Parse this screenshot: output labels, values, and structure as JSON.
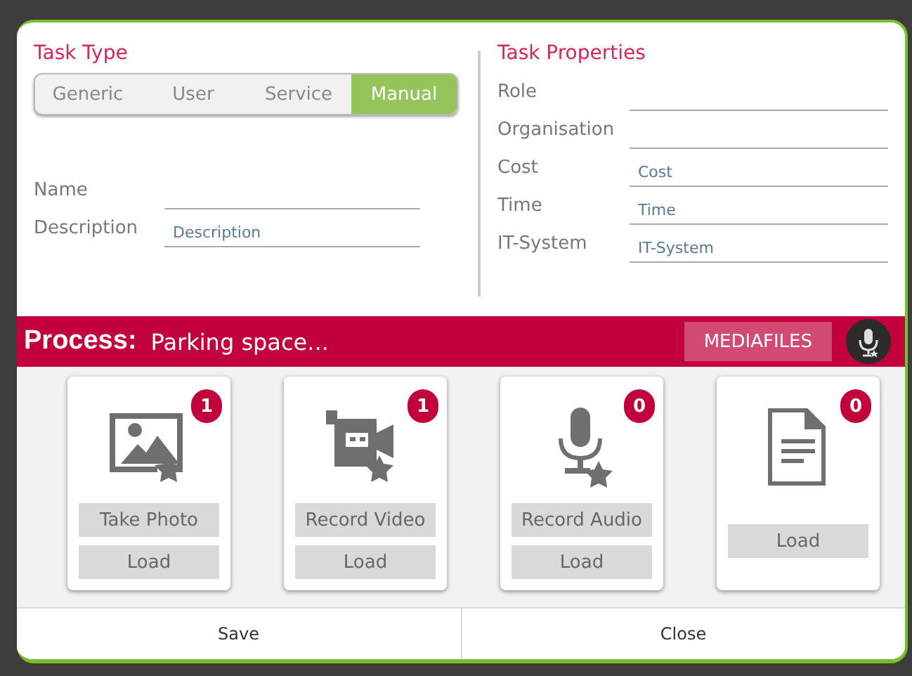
{
  "task_type": {
    "title": "Task Type",
    "options": [
      {
        "label": "Generic",
        "selected": false
      },
      {
        "label": "User",
        "selected": false
      },
      {
        "label": "Service",
        "selected": false
      },
      {
        "label": "Manual",
        "selected": true
      }
    ],
    "fields": [
      {
        "label": "Name"
      },
      {
        "label": "Description",
        "placeholder": "Description"
      }
    ]
  },
  "task_properties": {
    "title": "Task Properties",
    "fields": [
      {
        "label": "Role"
      },
      {
        "label": "Organisation"
      },
      {
        "label": "Cost",
        "placeholder": "Cost"
      },
      {
        "label": "Time",
        "placeholder": "Time"
      },
      {
        "label": "IT-System",
        "placeholder": "IT-System"
      }
    ]
  },
  "process_bar": {
    "label": "Process:",
    "name": "Parking space...",
    "button": "MEDIAFILES"
  },
  "media_cards": [
    {
      "kind": "photo",
      "badge": "1",
      "buttons": [
        "Take Photo",
        "Load"
      ]
    },
    {
      "kind": "video",
      "badge": "1",
      "buttons": [
        "Record Video",
        "Load"
      ]
    },
    {
      "kind": "audio",
      "badge": "0",
      "buttons": [
        "Record Audio",
        "Load"
      ]
    },
    {
      "kind": "document",
      "badge": "0",
      "buttons": [
        "Load"
      ]
    }
  ],
  "footer": [
    "Save",
    "Close"
  ]
}
